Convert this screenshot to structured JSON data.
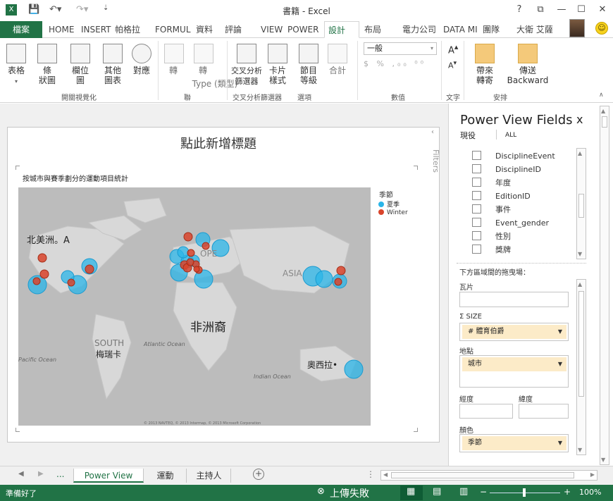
{
  "titlebar": {
    "title": "書籍 - Excel",
    "help": "?",
    "restore": "⧉",
    "minimize": "—",
    "maximize": "☐",
    "close": "✕"
  },
  "tabs": [
    {
      "label": "檔案"
    },
    {
      "label": "HOME"
    },
    {
      "label": "INSERT"
    },
    {
      "label": "帕格拉"
    },
    {
      "label": "FORMUL"
    },
    {
      "label": "資料"
    },
    {
      "label": "評論"
    },
    {
      "label": "VIEW"
    },
    {
      "label": "POWER"
    },
    {
      "label": "設計"
    },
    {
      "label": "布局"
    },
    {
      "label": "電力公司"
    },
    {
      "label": "DATA MI"
    },
    {
      "label": "團隊"
    },
    {
      "label": "大衛 艾薩"
    }
  ],
  "ribbon": {
    "table": "表格",
    "bar_l1": "條",
    "bar_l2": "狀圖",
    "column_l1": "欄位",
    "column_l2": "圖",
    "other_l1": "其他",
    "other_l2": "圖表",
    "map": "對應",
    "convert1": "轉",
    "convert2": "轉",
    "type_label": "Type (類型)",
    "slicer": "交叉分析篩選器",
    "card_l1": "卡片",
    "card_l2": "樣式",
    "tiles_l1": "節目",
    "tiles_l2": "等級",
    "total": "合計",
    "number_format": "一般",
    "bring_l1": "帶來",
    "bring_l2": "轉寄",
    "send_l1": "傳送",
    "send_l2": "Backward",
    "groups": {
      "switch_vis": "開關視覺化",
      "convert": "聯",
      "slicer_group": "交叉分析篩選器",
      "options": "選項",
      "number": "數值",
      "text": "文字",
      "arrange": "安排"
    }
  },
  "view": {
    "title_placeholder": "點此新增標題",
    "chart_title": "按城市與賽季劃分的運動項目統計",
    "filters_label": "Filters",
    "copyright": "© 2013 NAVTEQ, © 2013 Intermap, © 2013 Microsoft Corporation",
    "map_labels": {
      "north_america": "北美洲。A",
      "africa": "非洲裔",
      "south": "SOUTH",
      "south_america": "梅瑞卡",
      "australia": "奧西拉•",
      "asia": "ASIA",
      "europe": "OPE",
      "atlantic": "Atlantic Ocean",
      "pacific": "Pacific Ocean",
      "indian": "Indian Ocean"
    },
    "legend": {
      "title": "季節",
      "items": [
        {
          "label": "夏季",
          "color": "#2bb5e8"
        },
        {
          "label": "Winter",
          "color": "#d9442b"
        }
      ]
    }
  },
  "pane": {
    "title": "Power View Fields",
    "close": "x",
    "tab_current": "現役",
    "tab_all": "ALL",
    "fields": [
      "DisciplineEvent",
      "DisciplineID",
      "年度",
      "EditionID",
      "事件",
      "Event_gender",
      "性別",
      "獎牌"
    ],
    "drag_hint": "下方區域間的拖曳場：",
    "tiles_label": "瓦片",
    "size_label": "SIZE",
    "size_value": "# 體育伯爵",
    "location_label": "地點",
    "location_value": "城市",
    "lat_label": "經度",
    "lon_label": "緯度",
    "color_label": "顏色",
    "color_value": "季節"
  },
  "sheets": {
    "ellipsis": "...",
    "tabs": [
      "Power View",
      "運動",
      "主持人"
    ],
    "add": "+"
  },
  "status": {
    "ready": "準備好了",
    "upload": "上傳失敗",
    "zoom": "100%"
  }
}
